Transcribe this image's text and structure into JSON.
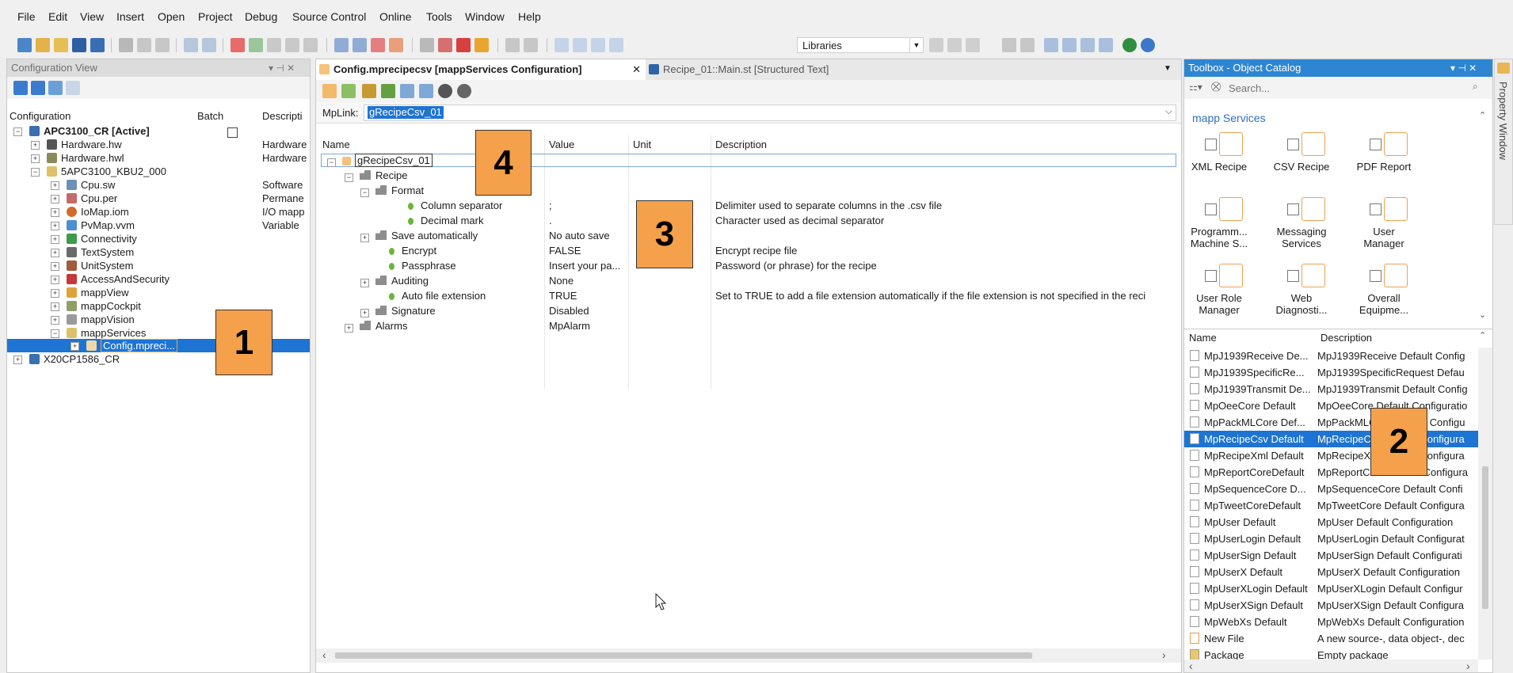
{
  "menu": [
    "File",
    "Edit",
    "View",
    "Insert",
    "Open",
    "Project",
    "Debug",
    "Source Control",
    "Online",
    "Tools",
    "Window",
    "Help"
  ],
  "toolbar": {
    "libraries_label": "Libraries"
  },
  "config_view": {
    "title": "Configuration View",
    "columns": {
      "configuration": "Configuration",
      "batch": "Batch",
      "description": "Descripti"
    },
    "items": [
      {
        "label": "APC3100_CR [Active]",
        "desc": ""
      },
      {
        "label": "Hardware.hw",
        "desc": "Hardware"
      },
      {
        "label": "Hardware.hwl",
        "desc": "Hardware"
      },
      {
        "label": "5APC3100_KBU2_000",
        "desc": ""
      },
      {
        "label": "Cpu.sw",
        "desc": "Software"
      },
      {
        "label": "Cpu.per",
        "desc": "Permane"
      },
      {
        "label": "IoMap.iom",
        "desc": "I/O mapp"
      },
      {
        "label": "PvMap.vvm",
        "desc": "Variable"
      },
      {
        "label": "Connectivity",
        "desc": ""
      },
      {
        "label": "TextSystem",
        "desc": ""
      },
      {
        "label": "UnitSystem",
        "desc": ""
      },
      {
        "label": "AccessAndSecurity",
        "desc": ""
      },
      {
        "label": "mappView",
        "desc": ""
      },
      {
        "label": "mappCockpit",
        "desc": ""
      },
      {
        "label": "mappVision",
        "desc": ""
      },
      {
        "label": "mappServices",
        "desc": ""
      },
      {
        "label": "Config.mpreci...",
        "desc": ""
      },
      {
        "label": "X20CP1586_CR",
        "desc": ""
      }
    ]
  },
  "editor": {
    "tabs": [
      {
        "label": "Config.mprecipecsv [mappServices Configuration]"
      },
      {
        "label": "Recipe_01::Main.st [Structured Text]"
      }
    ],
    "mplink_label": "MpLink:",
    "mplink_value": "gRecipeCsv_01",
    "columns": {
      "name": "Name",
      "value": "Value",
      "unit": "Unit",
      "description": "Description"
    },
    "rows": [
      {
        "name": "gRecipeCsv_01",
        "value": "",
        "unit": "",
        "description": ""
      },
      {
        "name": "Recipe",
        "value": "",
        "unit": "",
        "description": ""
      },
      {
        "name": "Format",
        "value": "",
        "unit": "",
        "description": ""
      },
      {
        "name": "Column separator",
        "value": ";",
        "unit": "",
        "description": "Delimiter used to separate columns in the .csv file"
      },
      {
        "name": "Decimal mark",
        "value": ".",
        "unit": "",
        "description": "Character used as decimal separator"
      },
      {
        "name": "Save automatically",
        "value": "No auto save",
        "unit": "",
        "description": ""
      },
      {
        "name": "Encrypt",
        "value": "FALSE",
        "unit": "",
        "description": "Encrypt recipe file"
      },
      {
        "name": "Passphrase",
        "value": "Insert your pa...",
        "unit": "",
        "description": "Password (or phrase) for the recipe"
      },
      {
        "name": "Auditing",
        "value": "None",
        "unit": "",
        "description": ""
      },
      {
        "name": "Auto file extension",
        "value": "TRUE",
        "unit": "",
        "description": "Set to TRUE to add a file extension automatically if the file extension is not specified in the reci"
      },
      {
        "name": "Signature",
        "value": "Disabled",
        "unit": "",
        "description": ""
      },
      {
        "name": "Alarms",
        "value": "MpAlarm",
        "unit": "",
        "description": ""
      }
    ]
  },
  "toolbox": {
    "title": "Toolbox - Object Catalog",
    "search_placeholder": "Search...",
    "category": "mapp Services",
    "items": [
      {
        "label": "XML Recipe"
      },
      {
        "label": "CSV Recipe"
      },
      {
        "label": "PDF Report"
      },
      {
        "label": "Programm... Machine S..."
      },
      {
        "label": "Messaging Services"
      },
      {
        "label": "User Manager"
      },
      {
        "label": "User Role Manager"
      },
      {
        "label": "Web Diagnosti..."
      },
      {
        "label": "Overall Equipme..."
      }
    ],
    "list_columns": {
      "name": "Name",
      "description": "Description"
    },
    "list": [
      {
        "name": "MpJ1939Receive De...",
        "desc": "MpJ1939Receive Default Config"
      },
      {
        "name": "MpJ1939SpecificRe...",
        "desc": "MpJ1939SpecificRequest Defau"
      },
      {
        "name": "MpJ1939Transmit De...",
        "desc": "MpJ1939Transmit Default Config"
      },
      {
        "name": "MpOeeCore Default",
        "desc": "MpOeeCore Default Configuratio"
      },
      {
        "name": "MpPackMLCore Def...",
        "desc": "MpPackMLCore Default Configu"
      },
      {
        "name": "MpRecipeCsv Default",
        "desc": "MpRecipeCsv Default Configura"
      },
      {
        "name": "MpRecipeXml Default",
        "desc": "MpRecipeXml Default Configura"
      },
      {
        "name": "MpReportCoreDefault",
        "desc": "MpReportCore Default Configura"
      },
      {
        "name": "MpSequenceCore D...",
        "desc": "MpSequenceCore Default Confi"
      },
      {
        "name": "MpTweetCoreDefault",
        "desc": "MpTweetCore Default Configura"
      },
      {
        "name": "MpUser Default",
        "desc": "MpUser Default Configuration"
      },
      {
        "name": "MpUserLogin Default",
        "desc": "MpUserLogin Default Configurat"
      },
      {
        "name": "MpUserSign Default",
        "desc": "MpUserSign Default Configurati"
      },
      {
        "name": "MpUserX Default",
        "desc": "MpUserX Default Configuration"
      },
      {
        "name": "MpUserXLogin Default",
        "desc": "MpUserXLogin Default Configur"
      },
      {
        "name": "MpUserXSign Default",
        "desc": "MpUserXSign Default Configura"
      },
      {
        "name": "MpWebXs Default",
        "desc": "MpWebXs Default Configuration"
      },
      {
        "name": "New File",
        "desc": "A new source-, data object-, dec"
      },
      {
        "name": "Package",
        "desc": "Empty package"
      }
    ]
  },
  "property_window": {
    "label": "Property Window"
  },
  "callouts": [
    "1",
    "2",
    "3",
    "4"
  ],
  "colors": {
    "accent": "#2e86d3",
    "selection": "#1e74d2",
    "callout": "#f5a04a"
  }
}
